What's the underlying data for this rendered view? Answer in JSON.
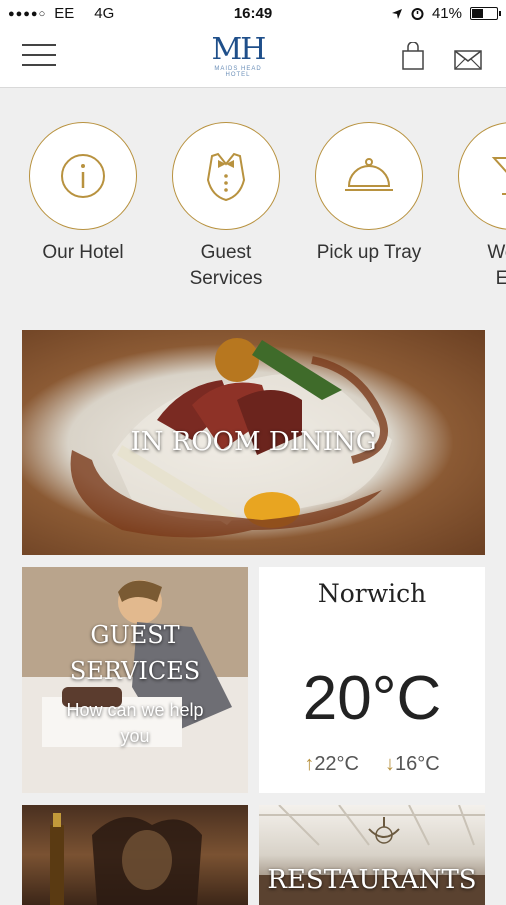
{
  "status_bar": {
    "signal_dots": "●●●●○",
    "carrier": "EE",
    "network": "4G",
    "time": "16:49",
    "battery_percent": "41%",
    "battery_level": 0.41
  },
  "header": {
    "logo_text": "MH",
    "logo_subtext": "MAIDS HEAD HOTEL"
  },
  "quick_links": [
    {
      "label": "Our Hotel",
      "icon": "info-icon"
    },
    {
      "label": "Guest\nServices",
      "icon": "bowtie-icon"
    },
    {
      "label": "Pick up Tray",
      "icon": "cloche-icon"
    },
    {
      "label": "Wedd\nEve",
      "icon": "cocktail-icon"
    }
  ],
  "tiles": {
    "dining": {
      "title": "IN ROOM DINING"
    },
    "guest_services": {
      "title": "GUEST SERVICES",
      "subtitle": "How can we help you"
    },
    "weather": {
      "city": "Norwich",
      "temperature": "20°C",
      "high": "22°C",
      "low": "16°C"
    },
    "restaurants": {
      "title": "RESTAURANTS"
    }
  },
  "colors": {
    "gold": "#b8923f",
    "brand_blue": "#1f4f8a"
  }
}
